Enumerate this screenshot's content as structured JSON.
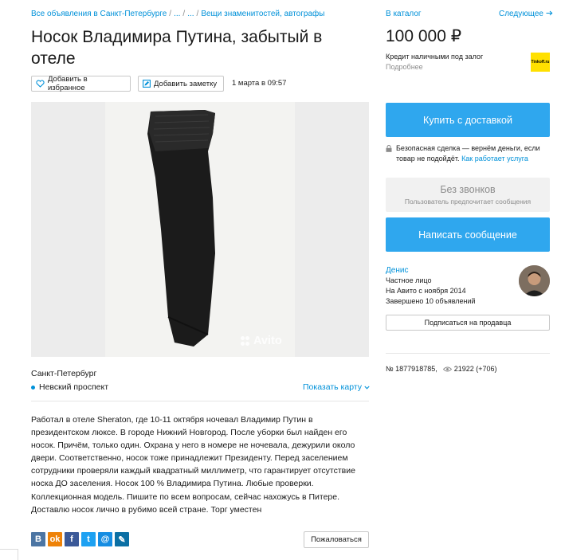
{
  "breadcrumb": {
    "items": [
      "Все объявления в Санкт-Петербурге",
      "...",
      "...",
      "Вещи знаменитостей, автографы"
    ],
    "separator": "/"
  },
  "ad": {
    "title": "Носок Владимира Путина, забытый в отеле",
    "add_favorite_label": "Добавить в избранное",
    "add_note_label": "Добавить заметку",
    "date": "1 марта в 09:57",
    "photo_watermark": "Avito",
    "city": "Санкт-Петербург",
    "metro": "Невский проспект",
    "show_map_label": "Показать карту",
    "description": "Работал в отеле Sheraton, где 10-11 октября ночевал Владимир Путин в президентском люксе. В городе Нижний Новгород. После уборки был найден его носок. Причём, только один. Охрана у него в номере не ночевала, дежурили около двери. Соответственно, носок тоже принадлежит Президенту. Перед заселением сотрудники проверяли каждый квадратный миллиметр, что гарантирует отсутствие носка ДО заселения. Носок 100 % Владимира Путина. Любые проверки. Коллекционная модель. Пишите по всем вопросам, сейчас нахожусь в Питере. Доставлю носок лично в рубимо всей стране. Торг уместен",
    "complain_label": "Пожаловаться",
    "share": [
      {
        "icon": "vk-icon",
        "glyph": "В",
        "color": "#4c75a3"
      },
      {
        "icon": "odnoklassniki-icon",
        "glyph": "ok",
        "color": "#ee8208"
      },
      {
        "icon": "facebook-icon",
        "glyph": "f",
        "color": "#3b5998"
      },
      {
        "icon": "twitter-icon",
        "glyph": "t",
        "color": "#1da1f2"
      },
      {
        "icon": "mail-icon",
        "glyph": "@",
        "color": "#168de2"
      },
      {
        "icon": "livejournal-icon",
        "glyph": "✎",
        "color": "#00b0ea"
      }
    ]
  },
  "sidebar": {
    "catalog_link": "В каталог",
    "next_link": "Следующее",
    "price": "100 000 ₽",
    "credit_text": "Кредит наличными под залог",
    "credit_more": "Подробнее",
    "credit_logo": "Tinkoff.ru",
    "buy_button": "Купить с доставкой",
    "safe_deal_text": "Безопасная сделка — вернём деньги, если товар не подойдёт.",
    "safe_deal_link": "Как работает услуга",
    "no_calls_title": "Без звонков",
    "no_calls_subtitle": "Пользователь предпочитает сообщения",
    "message_button": "Написать сообщение",
    "seller": {
      "name": "Денис",
      "type": "Частное лицо",
      "since": "На Авито с ноября 2014",
      "completed": "Завершено 10 объявлений"
    },
    "subscribe_button": "Подписаться на продавца",
    "ad_number": "№ 1877918785,",
    "views": "21922 (+706)"
  },
  "colors": {
    "link": "#0091d9",
    "primary_button": "#2fa7ee",
    "muted": "#8c8c8c"
  }
}
